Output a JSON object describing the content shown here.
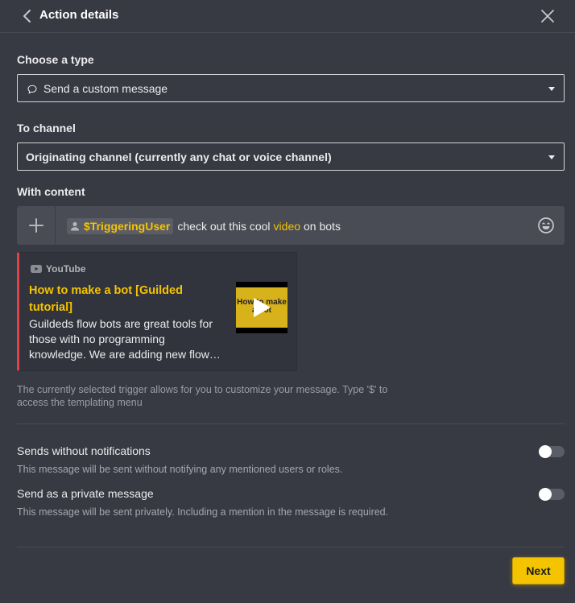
{
  "header": {
    "title": "Action details"
  },
  "type_section": {
    "label": "Choose a type",
    "selected": "Send a custom message"
  },
  "channel_section": {
    "label": "To channel",
    "selected": "Originating channel (currently any chat or voice channel)"
  },
  "content_section": {
    "label": "With content",
    "mention": "$TriggeringUser",
    "text_before": "check out this cool",
    "link_word": "video",
    "text_after": "on bots"
  },
  "embed": {
    "provider": "YouTube",
    "title": "How to make a bot [Guilded tutorial]",
    "description_lines": [
      "Guildeds flow bots are great tools for",
      "those with no programming",
      "knowledge. We are adding new flow…"
    ],
    "thumbnail_text": "How to make a bot",
    "accent_color": "#e0424a"
  },
  "hint": "The currently selected trigger allows for you to customize your message. Type '$' to access the templating menu",
  "options": [
    {
      "title": "Sends without notifications",
      "description": "This message will be sent without notifying any mentioned users or roles.",
      "enabled": false
    },
    {
      "title": "Send as a private message",
      "description": "This message will be sent privately. Including a mention in the message is required.",
      "enabled": false
    }
  ],
  "footer": {
    "next_label": "Next"
  },
  "colors": {
    "background": "#373943",
    "accent": "#f5c400",
    "input_bg": "#4a4c55"
  }
}
